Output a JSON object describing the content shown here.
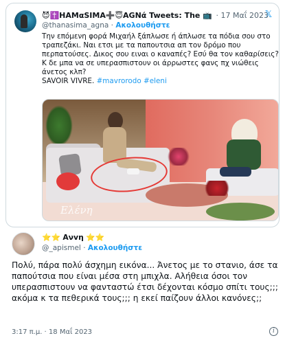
{
  "quoted_tweet": {
    "author_name": "😈✝️ΗΑΜαSIMA➕😇ΑGΝά Tweets: The 📺 ...",
    "separator": "·",
    "date": "17 Μαΐ 2023",
    "handle": "@thanasima_agna",
    "follow_dot": "·",
    "follow_label": "Ακολουθήστε",
    "text_line1": "Την επόμενη φορά Μιχαήλ ξάπλωσε ή άπλωσε τα πόδια σου στο τραπεζάκι. Ναι ετσι με τα παπουτσια απ τον δρόμο που περπατούσες. Δικος σου ειναι ο καναπές? Εσύ θα τον καθαρίσεις?Κ δε μπα να σε υπερασπιστουν οι άρρωστες φανς πχ νιώθεις άνετος κλπ?",
    "text_line2_prefix": "SAVOIR VIVRE. ",
    "hashtag1": "#mavrorodo",
    "hashtag2": "#eleni",
    "media_watermark": "Ελένη",
    "logo_icon": "x-logo-icon"
  },
  "reply_tweet": {
    "author_name": "Ανvη",
    "stars_before": "⭐⭐",
    "stars_after": "⭐⭐",
    "handle": "@_apismel",
    "follow_dot": "·",
    "follow_label": "Ακολουθήστε",
    "text": "Πολύ, πάρα πολύ άσχημη εικόνα... Άνετος με το στανιο, άσε τα παπούτσια που είναι μέσα στη μπιχλα. Αλήθεια όσοι τον υπερασπιστουν να φανταστώ έτσι δέχονται κόσμο σπίτι τους;;; ακόμα κ τα πεθερικά τους;;; η εκεί παίζουν άλλοι κανόνες;;",
    "timestamp": "3:17 π.μ. · 18 Μαΐ 2023",
    "info_icon": "info-icon"
  },
  "colors": {
    "link": "#1d9bf0",
    "muted": "#536471",
    "text": "#0f1419",
    "border": "#cfd9de",
    "circle_mark": "#e53935"
  }
}
